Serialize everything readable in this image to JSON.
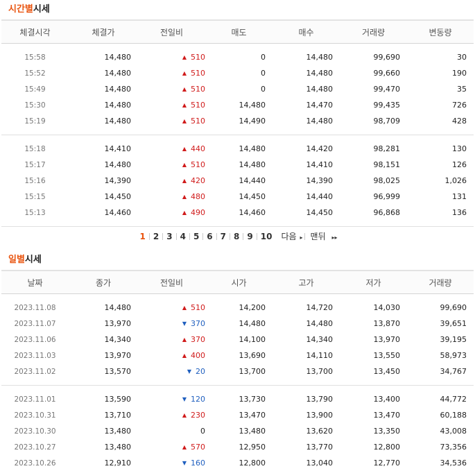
{
  "time_section": {
    "title_highlight": "시간별",
    "title_rest": "시세",
    "headers": [
      "체결시각",
      "체결가",
      "전일비",
      "매도",
      "매수",
      "거래량",
      "변동량"
    ],
    "rows": [
      {
        "time": "15:58",
        "price": "14,480",
        "dir": "up",
        "change": "510",
        "ask": "0",
        "bid": "14,480",
        "volume": "99,690",
        "delta": "30"
      },
      {
        "time": "15:52",
        "price": "14,480",
        "dir": "up",
        "change": "510",
        "ask": "0",
        "bid": "14,480",
        "volume": "99,660",
        "delta": "190"
      },
      {
        "time": "15:49",
        "price": "14,480",
        "dir": "up",
        "change": "510",
        "ask": "0",
        "bid": "14,480",
        "volume": "99,470",
        "delta": "35"
      },
      {
        "time": "15:30",
        "price": "14,480",
        "dir": "up",
        "change": "510",
        "ask": "14,480",
        "bid": "14,470",
        "volume": "99,435",
        "delta": "726"
      },
      {
        "time": "15:19",
        "price": "14,480",
        "dir": "up",
        "change": "510",
        "ask": "14,490",
        "bid": "14,480",
        "volume": "98,709",
        "delta": "428"
      },
      {
        "time": "15:18",
        "price": "14,410",
        "dir": "up",
        "change": "440",
        "ask": "14,480",
        "bid": "14,420",
        "volume": "98,281",
        "delta": "130"
      },
      {
        "time": "15:17",
        "price": "14,480",
        "dir": "up",
        "change": "510",
        "ask": "14,480",
        "bid": "14,410",
        "volume": "98,151",
        "delta": "126"
      },
      {
        "time": "15:16",
        "price": "14,390",
        "dir": "up",
        "change": "420",
        "ask": "14,440",
        "bid": "14,390",
        "volume": "98,025",
        "delta": "1,026"
      },
      {
        "time": "15:15",
        "price": "14,450",
        "dir": "up",
        "change": "480",
        "ask": "14,450",
        "bid": "14,440",
        "volume": "96,999",
        "delta": "131"
      },
      {
        "time": "15:13",
        "price": "14,460",
        "dir": "up",
        "change": "490",
        "ask": "14,460",
        "bid": "14,450",
        "volume": "96,868",
        "delta": "136"
      }
    ]
  },
  "pagination": {
    "pages": [
      "1",
      "2",
      "3",
      "4",
      "5",
      "6",
      "7",
      "8",
      "9",
      "10"
    ],
    "current": "1",
    "next_label": "다음",
    "last_label": "맨뒤",
    "next_arrow": "▸",
    "last_arrow": "▸▸"
  },
  "daily_section": {
    "title_highlight": "일별",
    "title_rest": "시세",
    "headers": [
      "날짜",
      "종가",
      "전일비",
      "시가",
      "고가",
      "저가",
      "거래량"
    ],
    "rows": [
      {
        "date": "2023.11.08",
        "close": "14,480",
        "dir": "up",
        "change": "510",
        "open": "14,200",
        "high": "14,720",
        "low": "14,030",
        "volume": "99,690"
      },
      {
        "date": "2023.11.07",
        "close": "13,970",
        "dir": "down",
        "change": "370",
        "open": "14,480",
        "high": "14,480",
        "low": "13,870",
        "volume": "39,651"
      },
      {
        "date": "2023.11.06",
        "close": "14,340",
        "dir": "up",
        "change": "370",
        "open": "14,100",
        "high": "14,340",
        "low": "13,970",
        "volume": "39,195"
      },
      {
        "date": "2023.11.03",
        "close": "13,970",
        "dir": "up",
        "change": "400",
        "open": "13,690",
        "high": "14,110",
        "low": "13,550",
        "volume": "58,973"
      },
      {
        "date": "2023.11.02",
        "close": "13,570",
        "dir": "down",
        "change": "20",
        "open": "13,700",
        "high": "13,700",
        "low": "13,450",
        "volume": "34,767"
      },
      {
        "date": "2023.11.01",
        "close": "13,590",
        "dir": "down",
        "change": "120",
        "open": "13,730",
        "high": "13,790",
        "low": "13,400",
        "volume": "44,772"
      },
      {
        "date": "2023.10.31",
        "close": "13,710",
        "dir": "up",
        "change": "230",
        "open": "13,470",
        "high": "13,900",
        "low": "13,470",
        "volume": "60,188"
      },
      {
        "date": "2023.10.30",
        "close": "13,480",
        "dir": "none",
        "change": "0",
        "open": "13,480",
        "high": "13,620",
        "low": "13,350",
        "volume": "43,008"
      },
      {
        "date": "2023.10.27",
        "close": "13,480",
        "dir": "up",
        "change": "570",
        "open": "12,950",
        "high": "13,770",
        "low": "12,800",
        "volume": "73,356"
      },
      {
        "date": "2023.10.26",
        "close": "12,910",
        "dir": "down",
        "change": "160",
        "open": "12,800",
        "high": "13,040",
        "low": "12,770",
        "volume": "34,536"
      }
    ]
  },
  "colors": {
    "accent": "#e9540f",
    "up": "#d01b1b",
    "down": "#1f5fbf"
  }
}
